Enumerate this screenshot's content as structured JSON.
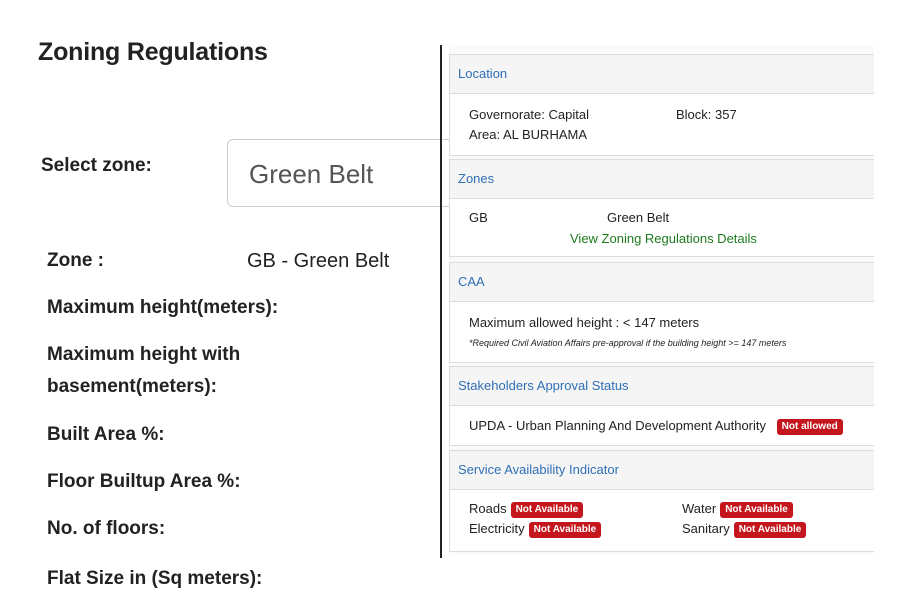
{
  "form": {
    "title": "Zoning Regulations",
    "select_label": "Select zone:",
    "select_value": "Green Belt",
    "zone_label": "Zone :",
    "zone_value": "GB - Green Belt",
    "max_height_label": "Maximum height(meters):",
    "max_height_basement_label_1": "Maximum height with",
    "max_height_basement_label_2": "basement(meters):",
    "built_area_label": "Built Area %:",
    "floor_builtup_label": "Floor Builtup Area %:",
    "floors_label": "No. of floors:",
    "flat_size_label": "Flat Size in (Sq meters):"
  },
  "panel": {
    "location": {
      "title": "Location",
      "governorate": "Governorate: Capital",
      "block": "Block: 357",
      "area": "Area: AL BURHAMA"
    },
    "zones": {
      "title": "Zones",
      "code": "GB",
      "name": "Green Belt",
      "link": "View Zoning Regulations Details"
    },
    "caa": {
      "title": "CAA",
      "max_height": "Maximum allowed height : < 147 meters",
      "note": "*Required Civil Aviation Affairs pre-approval if the building height >= 147 meters"
    },
    "stakeholders": {
      "title": "Stakeholders Approval Status",
      "authority": "UPDA - Urban Planning And Development Authority",
      "status": "Not allowed"
    },
    "services": {
      "title": "Service Availability Indicator",
      "roads": "Roads",
      "roads_status": "Not Available",
      "water": "Water",
      "water_status": "Not Available",
      "electricity": "Electricity",
      "electricity_status": "Not Available",
      "sanitary": "Sanitary",
      "sanitary_status": "Not Available"
    },
    "colors": {
      "header_link": "#2f6fb5",
      "link_green": "#1f7a1f",
      "badge_red": "#c4161c"
    }
  }
}
